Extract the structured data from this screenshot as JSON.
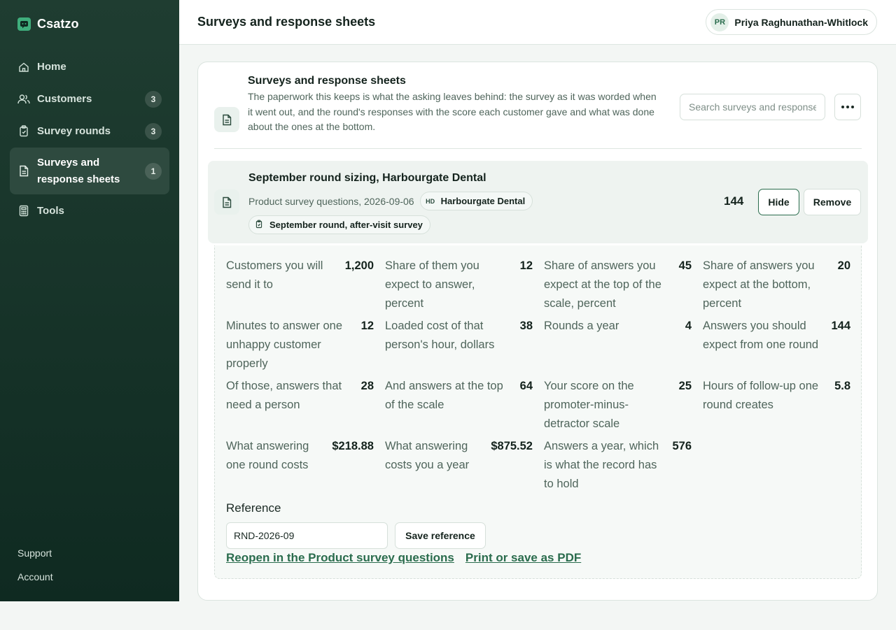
{
  "app": {
    "name": "Csatzo"
  },
  "sidebar": {
    "items": [
      {
        "label": "Home",
        "count": ""
      },
      {
        "label": "Customers",
        "count": "3"
      },
      {
        "label": "Survey rounds",
        "count": "3"
      },
      {
        "label": "Surveys and response sheets",
        "count": "1"
      },
      {
        "label": "Tools",
        "count": ""
      }
    ],
    "bottom": {
      "support": "Support",
      "account": "Account"
    }
  },
  "header": {
    "title": "Surveys and response sheets",
    "user": {
      "initials": "PR",
      "name": "Priya Raghunathan-Whitlock"
    }
  },
  "section": {
    "title": "Surveys and response sheets",
    "description": "The paperwork this keeps is what the asking leaves behind: the survey as it was worded when it went out, and the round's responses with the score each customer gave and what was done about the ones at the bottom.",
    "search_placeholder": "Search surveys and responses"
  },
  "item": {
    "title": "September round sizing, Harbourgate Dental",
    "subtitle": "Product survey questions, 2026-09-06",
    "customer_tag": {
      "initials": "HD",
      "label": "Harbourgate Dental"
    },
    "round_tag": "September round, after-visit survey",
    "count": "144",
    "hide_label": "Hide",
    "remove_label": "Remove"
  },
  "details": {
    "cells": [
      {
        "label": "Customers you will send it to",
        "value": "1,200"
      },
      {
        "label": "Share of them you expect to answer, percent",
        "value": "12"
      },
      {
        "label": "Share of answers you expect at the top of the scale, percent",
        "value": "45"
      },
      {
        "label": "Share of answers you expect at the bottom, percent",
        "value": "20"
      },
      {
        "label": "Minutes to answer one unhappy customer properly",
        "value": "12"
      },
      {
        "label": "Loaded cost of that person's hour, dollars",
        "value": "38"
      },
      {
        "label": "Rounds a year",
        "value": "4"
      },
      {
        "label": "Answers you should expect from one round",
        "value": "144"
      },
      {
        "label": "Of those, answers that need a person",
        "value": "28"
      },
      {
        "label": "And answers at the top of the scale",
        "value": "64"
      },
      {
        "label": "Your score on the promoter-minus-detractor scale",
        "value": "25"
      },
      {
        "label": "Hours of follow-up one round creates",
        "value": "5.8"
      },
      {
        "label": "What answering one round costs",
        "value": "$218.88"
      },
      {
        "label": "What answering costs you a year",
        "value": "$875.52"
      },
      {
        "label": "Answers a year, which is what the record has to hold",
        "value": "576"
      }
    ],
    "reference_label": "Reference",
    "reference_value": "RND-2026-09",
    "save_label": "Save reference",
    "reopen_link": "Reopen in the Product survey questions",
    "print_link": "Print or save as PDF"
  }
}
